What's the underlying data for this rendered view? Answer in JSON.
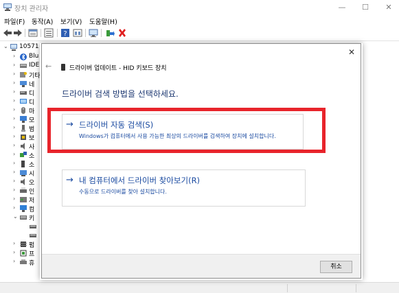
{
  "window": {
    "title": "장치 관리자",
    "controls": {
      "minimize": "—",
      "maximize": "☐",
      "close": "✕"
    }
  },
  "menu": [
    {
      "label": "파일(F)"
    },
    {
      "label": "동작(A)"
    },
    {
      "label": "보기(V)"
    },
    {
      "label": "도움말(H)"
    }
  ],
  "tree": {
    "root": "10571",
    "items": [
      {
        "label": "Blu"
      },
      {
        "label": "IDE"
      },
      {
        "label": "기타"
      },
      {
        "label": "네"
      },
      {
        "label": "디"
      },
      {
        "label": "디"
      },
      {
        "label": "마"
      },
      {
        "label": "모"
      },
      {
        "label": "범"
      },
      {
        "label": "보"
      },
      {
        "label": "사"
      },
      {
        "label": "소"
      },
      {
        "label": "소"
      },
      {
        "label": "시"
      },
      {
        "label": "오"
      },
      {
        "label": "인"
      },
      {
        "label": "저"
      },
      {
        "label": "컴"
      },
      {
        "label": "키"
      },
      {
        "label": ""
      },
      {
        "label": ""
      },
      {
        "label": "펌"
      },
      {
        "label": "프"
      },
      {
        "label": "휴"
      }
    ]
  },
  "dialog": {
    "close": "✕",
    "back": "←",
    "heading": "드라이버 업데이트 - HID 키보드 장치",
    "question": "드라이버 검색 방법을 선택하세요.",
    "options": [
      {
        "arrow": "→",
        "title": "드라이버 자동 검색(S)",
        "desc": "Windows가 컴퓨터에서 사용 가능한 최상의 드라이버를 검색하여 장치에 설치합니다."
      },
      {
        "arrow": "→",
        "title": "내 컴퓨터에서 드라이버 찾아보기(R)",
        "desc": "수동으로 드라이버를 찾아 설치합니다."
      }
    ],
    "cancel": "취소"
  },
  "colors": {
    "highlight": "#e8242b",
    "link": "#1a4aa0",
    "question": "#1f3a73"
  }
}
